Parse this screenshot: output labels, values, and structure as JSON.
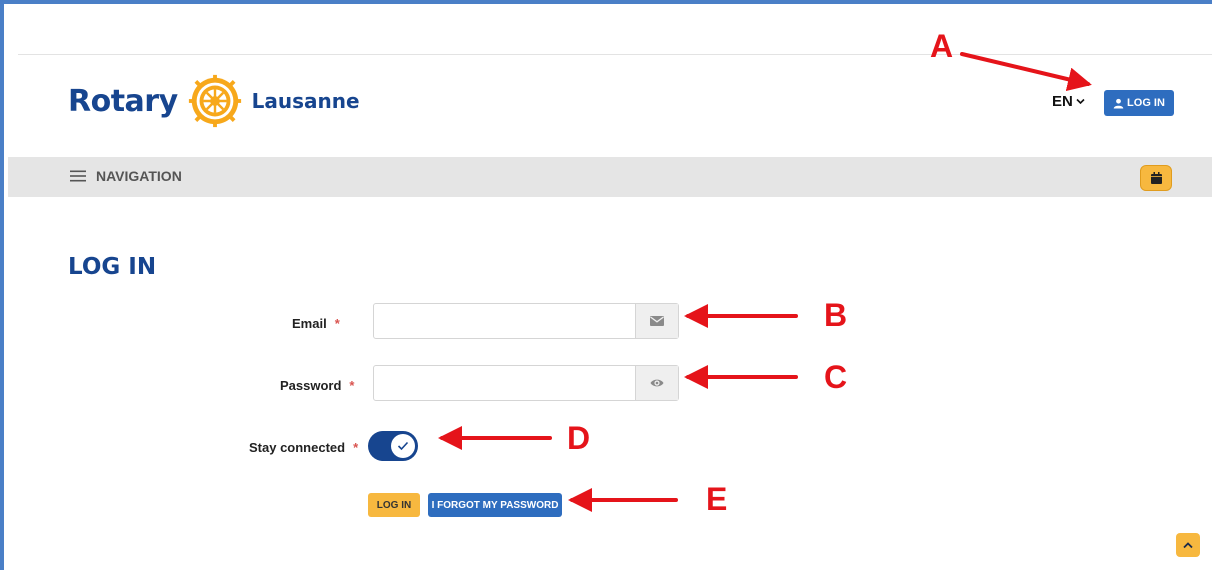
{
  "header": {
    "logo_word": "Rotary",
    "logo_city": "Lausanne",
    "language": "EN",
    "login_button": "LOG IN"
  },
  "navbar": {
    "menu_label": "NAVIGATION"
  },
  "form": {
    "title": "LOG IN",
    "email_label": "Email",
    "email_value": "",
    "password_label": "Password",
    "password_value": "",
    "stay_connected_label": "Stay connected",
    "stay_connected_on": true,
    "required_marker": "*",
    "login_button": "LOG IN",
    "forgot_button": "I FORGOT MY PASSWORD"
  },
  "annotations": {
    "a": "A",
    "b": "B",
    "c": "C",
    "d": "D",
    "e": "E"
  },
  "colors": {
    "brand_blue": "#17458f",
    "button_blue": "#2e6dbf",
    "gold": "#f7b83f",
    "annotation_red": "#e5141a"
  },
  "icons": {
    "user": "user-icon",
    "chevron": "chevron-down-icon",
    "menu": "hamburger-icon",
    "calendar": "calendar-icon",
    "email": "envelope-icon",
    "password": "eye-icon",
    "check": "check-icon",
    "scroll_up": "chevron-up-icon"
  }
}
